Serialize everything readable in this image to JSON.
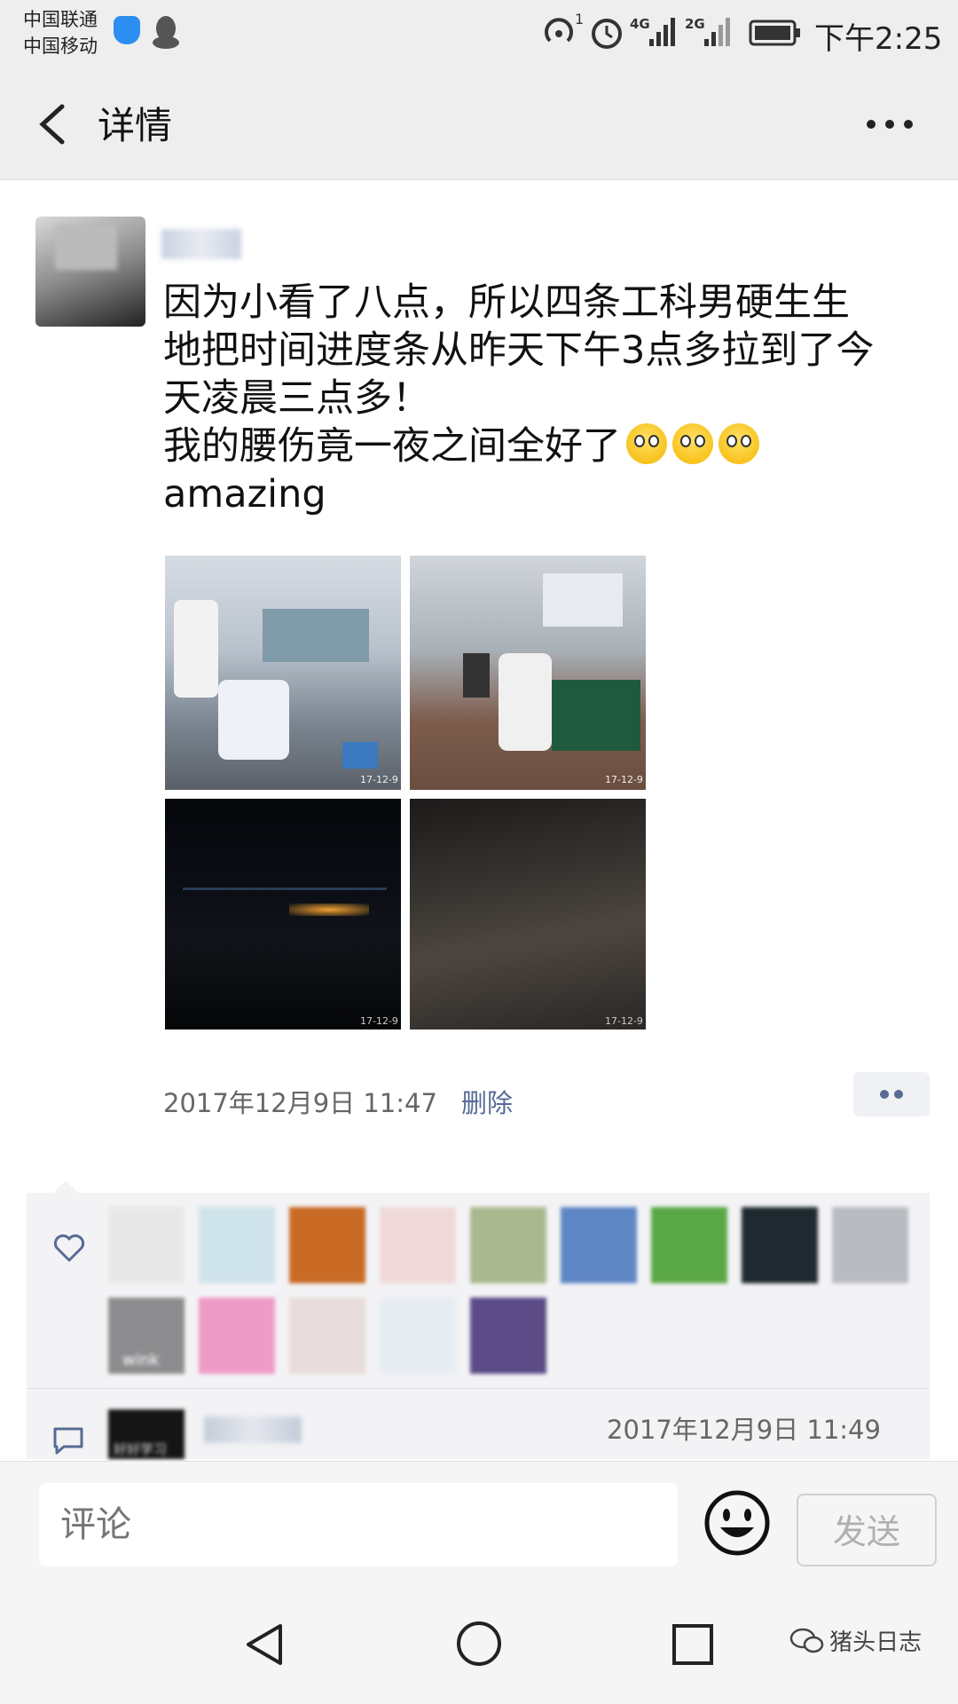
{
  "status_bar": {
    "carrier_1": "中国联通",
    "carrier_2": "中国移动",
    "hotspot_superscript": "1",
    "network_1": "4G",
    "network_2": "2G",
    "time": "下午2:25"
  },
  "header": {
    "title": "详情"
  },
  "post": {
    "lines": [
      "因为小看了八点，所以四条工科男硬生生",
      "地把时间进度条从昨天下午3点多拉到了今",
      "天凌晨三点多！",
      "我的腰伤竟一夜之间全好了",
      "amazing"
    ],
    "photo_stamp": "17-12-9",
    "timestamp": "2017年12月9日 11:47",
    "delete_label": "删除"
  },
  "likes": {
    "avatar_caption": "wink"
  },
  "comment": {
    "timestamp": "2017年12月9日 11:49",
    "avatar_caption": "好好学习"
  },
  "comment_bar": {
    "placeholder": "评论",
    "send_label": "发送"
  },
  "watermark": {
    "text": "猪头日志"
  },
  "colors": {
    "bar_background": "#eeeeee",
    "link": "#576b95",
    "likes_background": "#f3f3f5"
  }
}
